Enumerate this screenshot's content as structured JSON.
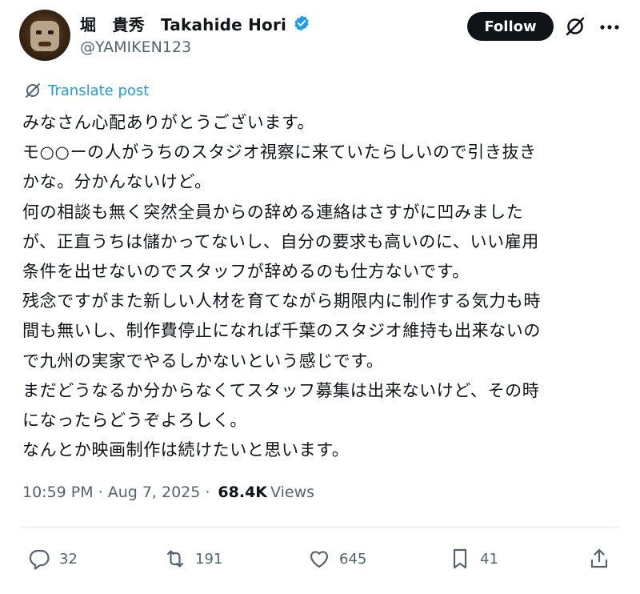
{
  "author": {
    "display_name": "堀　貴秀　Takahide Hori",
    "handle": "@YAMIKEN123",
    "verified": true
  },
  "header": {
    "follow_label": "Follow",
    "icons": [
      "grok-icon",
      "more-icon"
    ]
  },
  "translate": {
    "label": "Translate post"
  },
  "post": {
    "lines": [
      "みなさん心配ありがとうございます。",
      "モ○○ーの人がうちのスタジオ視察に来ていたらしいので引き抜き",
      "かな。分かんないけど。",
      "何の相談も無く突然全員からの辞める連絡はさすがに凹みました",
      "が、正直うちは儲かってないし、自分の要求も高いのに、いい雇用",
      "条件を出せないのでスタッフが辞めるのも仕方ないです。",
      "残念ですがまた新しい人材を育てながら期限内に制作する気力も時",
      "間も無いし、制作費停止になれば千葉のスタジオ維持も出来ないの",
      "で九州の実家でやるしかないという感じです。",
      "まだどうなるか分からなくてスタッフ募集は出来ないけど、その時",
      "になったらどうぞよろしく。",
      "なんとか映画制作は続けたいと思います。"
    ]
  },
  "meta": {
    "time": "10:59 PM",
    "date": "Aug 7, 2025",
    "views_count": "68.4K",
    "views_label": "Views",
    "separator": "·"
  },
  "actions": {
    "replies": "32",
    "reposts": "191",
    "likes": "645",
    "bookmarks": "41"
  },
  "colors": {
    "accent": "#1d9bf0",
    "text": "#0f1419",
    "muted": "#536471"
  }
}
